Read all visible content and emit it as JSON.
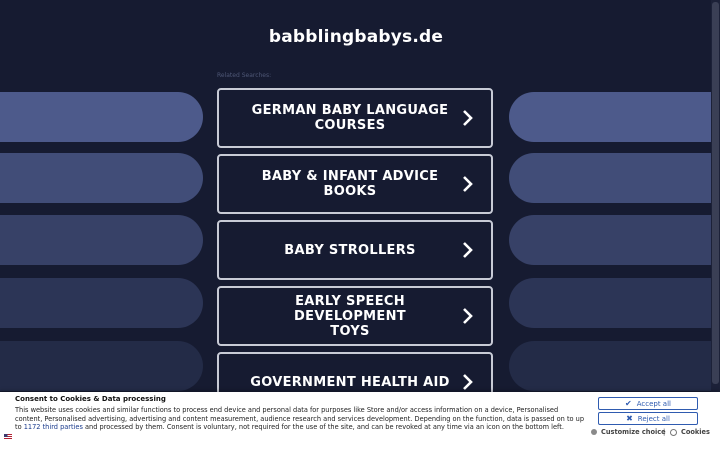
{
  "site": {
    "domain": "babblingbabys.de"
  },
  "related_label": "Related Searches:",
  "results": [
    {
      "line1": "GERMAN BABY LANGUAGE",
      "line2": "COURSES"
    },
    {
      "line1": "BABY & INFANT ADVICE BOOKS",
      "line2": ""
    },
    {
      "line1": "BABY STROLLERS",
      "line2": ""
    },
    {
      "line1": "EARLY SPEECH DEVELOPMENT",
      "line2": "TOYS"
    },
    {
      "line1": "GOVERNMENT HEALTH AID",
      "line2": ""
    }
  ],
  "consent": {
    "title": "Consent to Cookies & Data processing",
    "text_before_link": "This website uses cookies and similar functions to process end device and personal data for purposes like Store and/or access information on a device, Personalised content, Personalised advertising, advertising and content measurement, audience research and services development. Depending on the function, data is passed on to up to ",
    "link_text": "1172 third parties",
    "text_after_link": " and processed by them. Consent is voluntary, not required for the use of the site, and can be revoked at any time via an icon on the bottom left.",
    "accept_label": "Accept all",
    "reject_label": "Reject all",
    "customize_label": "Customize choice",
    "separator": "|",
    "cookies_label": "Cookies"
  },
  "colors": {
    "background": "#161b31",
    "card_border": "#c8cbd6",
    "button_blue": "#2f5bb0",
    "stripe_1": "#4d5b8c",
    "stripe_5": "#222b48"
  }
}
